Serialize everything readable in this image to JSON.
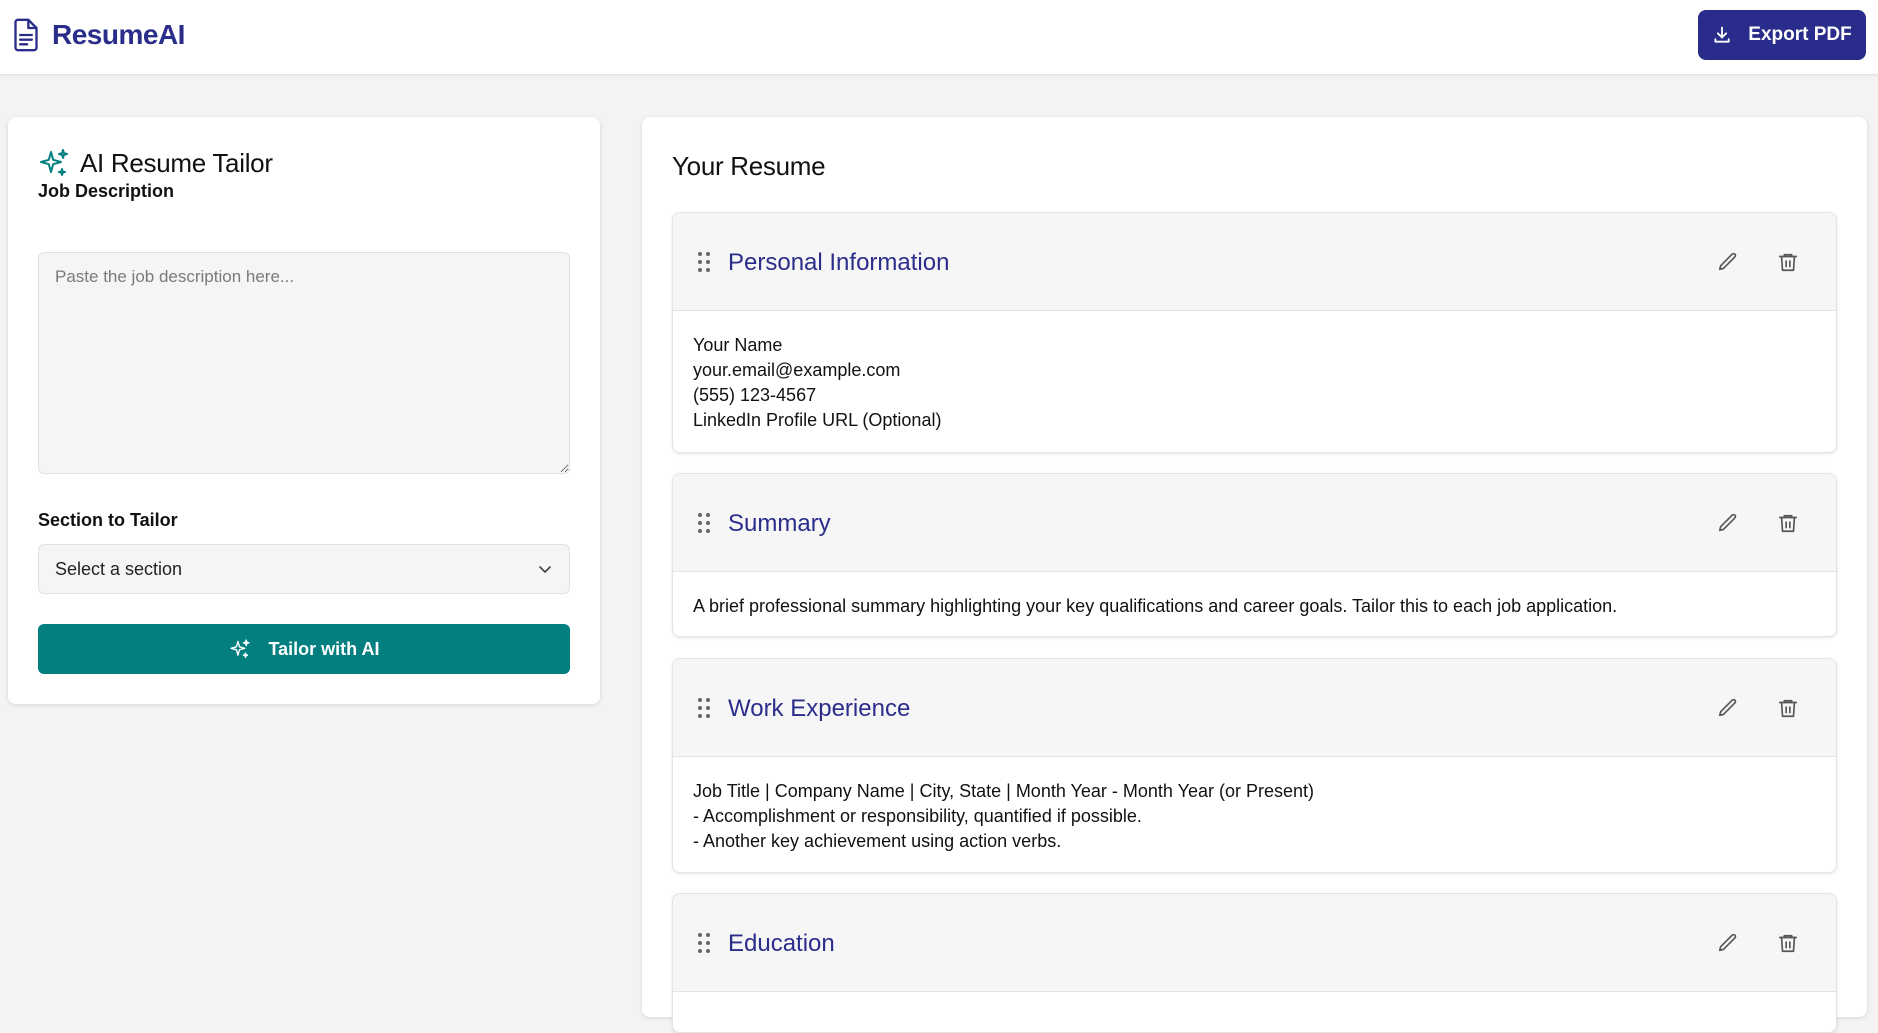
{
  "header": {
    "brand": "ResumeAI",
    "export_label": "Export PDF"
  },
  "tailor": {
    "title": "AI Resume Tailor",
    "job_description_label": "Job Description",
    "job_description_placeholder": "Paste the job description here...",
    "job_description_value": "",
    "section_label": "Section to Tailor",
    "section_selected": "Select a section",
    "button_label": "Tailor with AI"
  },
  "resume": {
    "title": "Your Resume",
    "sections": [
      {
        "name": "Personal Information",
        "lines": [
          "Your Name",
          "your.email@example.com",
          "(555) 123-4567",
          "LinkedIn Profile URL (Optional)"
        ]
      },
      {
        "name": "Summary",
        "lines": [
          "A brief professional summary highlighting your key qualifications and career goals. Tailor this to each job application."
        ]
      },
      {
        "name": "Work Experience",
        "lines": [
          "Job Title | Company Name | City, State | Month Year - Month Year (or Present)",
          "- Accomplishment or responsibility, quantified if possible.",
          "- Another key achievement using action verbs."
        ]
      },
      {
        "name": "Education",
        "lines": []
      }
    ]
  },
  "colors": {
    "brand": "#2b2d8a",
    "accent_teal": "#037f80",
    "background": "#f3f3f3"
  },
  "icons": {
    "brand": "document-icon",
    "export": "download-icon",
    "tailor": "sparkles-icon",
    "select": "chevron-down-icon",
    "drag": "drag-handle-icon",
    "edit": "pencil-icon",
    "delete": "trash-icon"
  }
}
